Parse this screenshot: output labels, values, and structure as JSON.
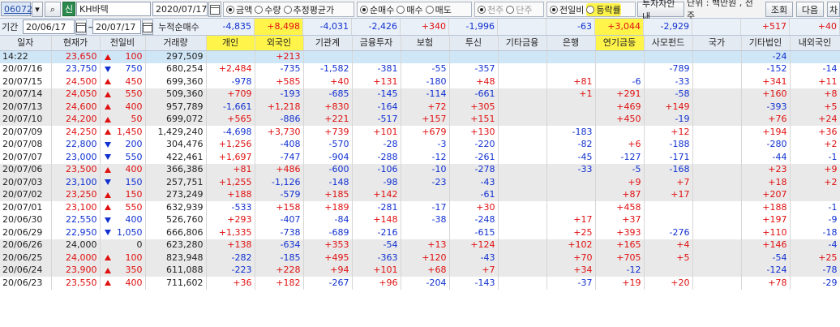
{
  "toolbar": {
    "code": "060720",
    "search_icon": "magnifier-icon",
    "tag": "신",
    "name": "KH바텍",
    "date": "2020/07/17",
    "radio_a": [
      {
        "label": "금액",
        "on": true
      },
      {
        "label": "수량",
        "on": false
      },
      {
        "label": "추정평균가",
        "on": false
      }
    ],
    "radio_b": [
      {
        "label": "순매수",
        "on": true
      },
      {
        "label": "매수",
        "on": false
      },
      {
        "label": "매도",
        "on": false
      }
    ],
    "radio_c": [
      {
        "label": "천주",
        "on": true
      },
      {
        "label": "단주",
        "on": false
      }
    ],
    "radio_d": [
      {
        "label": "전일비",
        "on": true
      },
      {
        "label": "등락률",
        "on": false
      }
    ],
    "investor_guide": "투자자안내",
    "unit_label": "단위 : 백만원 , 천주",
    "search_btn": "조회",
    "next_btn": "다음",
    "chart_btn": "차"
  },
  "period": {
    "label": "기간",
    "from": "20/06/17",
    "to": "20/07/17",
    "sep": "~",
    "cum_label": "누적순매수",
    "cum": [
      "-4,835",
      "+8,498",
      "-4,031",
      "-2,426",
      "+340",
      "-1,996",
      "",
      "-63",
      "+3,044",
      "-2,929",
      "",
      "+517",
      "+40"
    ]
  },
  "headers": [
    "일자",
    "현재가",
    "전일비",
    "거래량",
    "개인",
    "외국인",
    "기관계",
    "금융투자",
    "보험",
    "투신",
    "기타금융",
    "은행",
    "연기금등",
    "사모펀드",
    "국가",
    "기타법인",
    "내외국인"
  ],
  "rows": [
    [
      "14:22",
      "23,650",
      "up",
      "100",
      "297,509",
      "",
      "+213",
      "",
      "",
      "",
      "",
      "",
      "",
      "",
      "",
      "",
      "-24",
      ""
    ],
    [
      "20/07/16",
      "23,750",
      "dn",
      "750",
      "680,254",
      "+2,484",
      "-735",
      "-1,582",
      "-381",
      "-55",
      "-357",
      "",
      "",
      "",
      "-789",
      "",
      "-152",
      "-14"
    ],
    [
      "20/07/15",
      "24,500",
      "up",
      "450",
      "699,360",
      "-978",
      "+585",
      "+40",
      "+131",
      "-180",
      "+48",
      "",
      "+81",
      "-6",
      "-33",
      "",
      "+341",
      "+11"
    ],
    [
      "20/07/14",
      "24,050",
      "up",
      "550",
      "509,360",
      "+709",
      "-193",
      "-685",
      "-145",
      "-114",
      "-661",
      "",
      "+1",
      "+291",
      "-58",
      "",
      "+160",
      "+8"
    ],
    [
      "20/07/13",
      "24,600",
      "up",
      "400",
      "957,789",
      "-1,661",
      "+1,218",
      "+830",
      "-164",
      "+72",
      "+305",
      "",
      "",
      "+469",
      "+149",
      "",
      "-393",
      "+5"
    ],
    [
      "20/07/10",
      "24,200",
      "up",
      "50",
      "699,072",
      "+565",
      "-886",
      "+221",
      "-517",
      "+157",
      "+151",
      "",
      "",
      "+450",
      "-19",
      "",
      "+76",
      "+24"
    ],
    [
      "20/07/09",
      "24,250",
      "up",
      "1,450",
      "1,429,240",
      "-4,698",
      "+3,730",
      "+739",
      "+101",
      "+679",
      "+130",
      "",
      "-183",
      "",
      "+12",
      "",
      "+194",
      "+36"
    ],
    [
      "20/07/08",
      "22,800",
      "dn",
      "200",
      "304,476",
      "+1,256",
      "-408",
      "-570",
      "-28",
      "-3",
      "-220",
      "",
      "-82",
      "+6",
      "-188",
      "",
      "-280",
      "+2"
    ],
    [
      "20/07/07",
      "23,000",
      "dn",
      "550",
      "422,461",
      "+1,697",
      "-747",
      "-904",
      "-288",
      "-12",
      "-261",
      "",
      "-45",
      "-127",
      "-171",
      "",
      "-44",
      "-1"
    ],
    [
      "20/07/06",
      "23,500",
      "up",
      "400",
      "366,386",
      "+81",
      "+486",
      "-600",
      "-106",
      "-10",
      "-278",
      "",
      "-33",
      "-5",
      "-168",
      "",
      "+23",
      "+9"
    ],
    [
      "20/07/03",
      "23,100",
      "dn",
      "150",
      "257,751",
      "+1,255",
      "-1,126",
      "-148",
      "-98",
      "-23",
      "-43",
      "",
      "",
      "+9",
      "+7",
      "",
      "+18",
      "+2"
    ],
    [
      "20/07/02",
      "23,250",
      "up",
      "150",
      "273,249",
      "+188",
      "-579",
      "+185",
      "+142",
      "",
      "-61",
      "",
      "",
      "+87",
      "+17",
      "",
      "+207",
      ""
    ],
    [
      "20/07/01",
      "23,100",
      "up",
      "550",
      "632,939",
      "-533",
      "+158",
      "+189",
      "-281",
      "-17",
      "+30",
      "",
      "",
      "+458",
      "",
      "",
      "+188",
      "-1"
    ],
    [
      "20/06/30",
      "22,550",
      "dn",
      "400",
      "526,760",
      "+293",
      "-407",
      "-84",
      "+148",
      "-38",
      "-248",
      "",
      "+17",
      "+37",
      "",
      "",
      "+197",
      "-9"
    ],
    [
      "20/06/29",
      "22,950",
      "dn",
      "1,050",
      "666,806",
      "+1,335",
      "-738",
      "-689",
      "-216",
      "",
      "-615",
      "",
      "+25",
      "+393",
      "-276",
      "",
      "+110",
      "-18"
    ],
    [
      "20/06/26",
      "24,000",
      "",
      "0",
      "623,280",
      "+138",
      "-634",
      "+353",
      "-54",
      "+13",
      "+124",
      "",
      "+102",
      "+165",
      "+4",
      "",
      "+146",
      "-4"
    ],
    [
      "20/06/25",
      "24,000",
      "up",
      "100",
      "823,948",
      "-282",
      "-185",
      "+495",
      "-363",
      "+120",
      "-43",
      "",
      "+70",
      "+705",
      "+5",
      "",
      "-54",
      "+25"
    ],
    [
      "20/06/24",
      "23,900",
      "up",
      "350",
      "611,088",
      "-223",
      "+228",
      "+94",
      "+101",
      "+68",
      "+7",
      "",
      "+34",
      "-12",
      "",
      "",
      "-124",
      "-78"
    ],
    [
      "20/06/23",
      "23,550",
      "up",
      "400",
      "711,602",
      "+36",
      "+182",
      "-267",
      "+96",
      "-204",
      "-143",
      "",
      "-37",
      "+19",
      "+20",
      "",
      "+78",
      "-29"
    ]
  ]
}
